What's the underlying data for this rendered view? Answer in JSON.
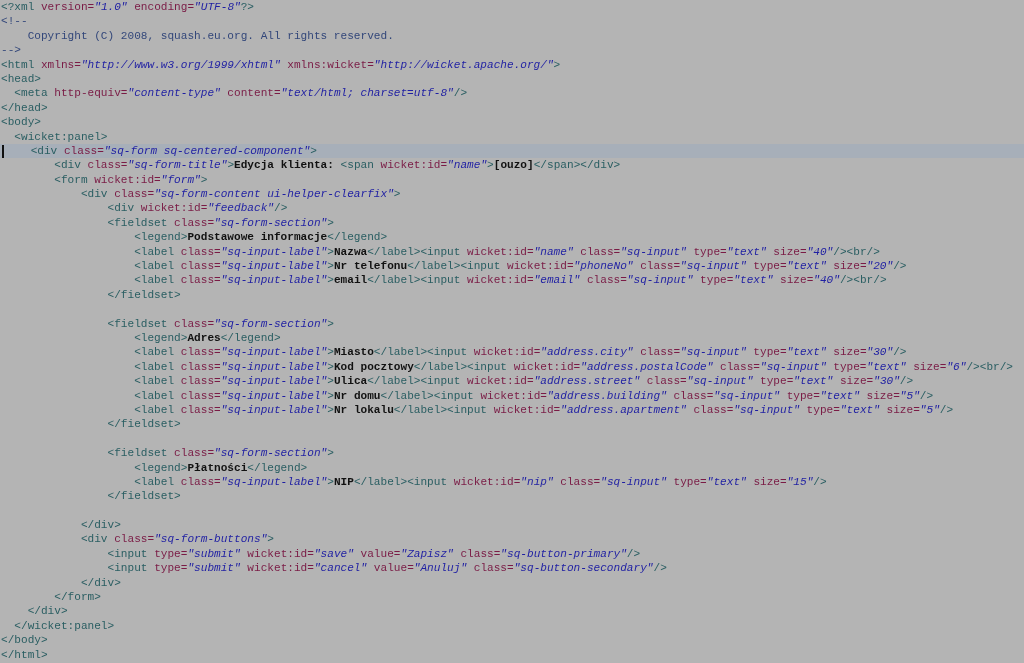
{
  "editor": {
    "lines": [
      {
        "kind": "code",
        "current": false,
        "tokens": [
          {
            "kind": "tag",
            "text": "<?xml"
          },
          {
            "kind": "attr",
            "text": " version="
          },
          {
            "kind": "value",
            "text": "\"1.0\""
          },
          {
            "kind": "attr",
            "text": " encoding="
          },
          {
            "kind": "value",
            "text": "\"UTF-8\""
          },
          {
            "kind": "tag",
            "text": "?>"
          }
        ]
      },
      {
        "kind": "code",
        "current": false,
        "tokens": [
          {
            "kind": "comment",
            "text": "<!--"
          }
        ]
      },
      {
        "kind": "code",
        "current": false,
        "tokens": [
          {
            "kind": "comment",
            "text": "    Copyright (C) 2008, squash.eu.org. All rights reserved."
          }
        ]
      },
      {
        "kind": "code",
        "current": false,
        "tokens": [
          {
            "kind": "comment",
            "text": "-->"
          }
        ]
      },
      {
        "kind": "code",
        "current": false,
        "tokens": [
          {
            "kind": "tag",
            "text": "<html"
          },
          {
            "kind": "attr",
            "text": " xmlns="
          },
          {
            "kind": "value",
            "text": "\"http://www.w3.org/1999/xhtml\""
          },
          {
            "kind": "attr",
            "text": " xmlns:wicket="
          },
          {
            "kind": "value",
            "text": "\"http://wicket.apache.org/\""
          },
          {
            "kind": "tag",
            "text": ">"
          }
        ]
      },
      {
        "kind": "code",
        "current": false,
        "tokens": [
          {
            "kind": "tag",
            "text": "<head>"
          }
        ]
      },
      {
        "kind": "code",
        "current": false,
        "tokens": [
          {
            "kind": "tag",
            "text": "  <meta"
          },
          {
            "kind": "attr",
            "text": " http-equiv="
          },
          {
            "kind": "value",
            "text": "\"content-type\""
          },
          {
            "kind": "attr",
            "text": " content="
          },
          {
            "kind": "value",
            "text": "\"text/html; charset=utf-8\""
          },
          {
            "kind": "tag",
            "text": "/>"
          }
        ]
      },
      {
        "kind": "code",
        "current": false,
        "tokens": [
          {
            "kind": "tag",
            "text": "</head>"
          }
        ]
      },
      {
        "kind": "code",
        "current": false,
        "tokens": [
          {
            "kind": "tag",
            "text": "<body>"
          }
        ]
      },
      {
        "kind": "code",
        "current": false,
        "tokens": [
          {
            "kind": "tag",
            "text": "  <wicket:panel>"
          }
        ]
      },
      {
        "kind": "code",
        "current": true,
        "tokens": [
          {
            "kind": "tag",
            "text": "    <div"
          },
          {
            "kind": "attr",
            "text": " class="
          },
          {
            "kind": "value",
            "text": "\"sq-form sq-centered-component\""
          },
          {
            "kind": "tag",
            "text": ">"
          }
        ]
      },
      {
        "kind": "code",
        "current": false,
        "tokens": [
          {
            "kind": "tag",
            "text": "        <div"
          },
          {
            "kind": "attr",
            "text": " class="
          },
          {
            "kind": "value",
            "text": "\"sq-form-title\""
          },
          {
            "kind": "tag",
            "text": ">"
          },
          {
            "kind": "text",
            "text": "Edycja klienta: "
          },
          {
            "kind": "tag",
            "text": "<span"
          },
          {
            "kind": "attr",
            "text": " wicket:id="
          },
          {
            "kind": "value",
            "text": "\"name\""
          },
          {
            "kind": "tag",
            "text": ">"
          },
          {
            "kind": "text",
            "text": "[ouzo]"
          },
          {
            "kind": "tag",
            "text": "</span></div>"
          }
        ]
      },
      {
        "kind": "code",
        "current": false,
        "tokens": [
          {
            "kind": "tag",
            "text": "        <form"
          },
          {
            "kind": "attr",
            "text": " wicket:id="
          },
          {
            "kind": "value",
            "text": "\"form\""
          },
          {
            "kind": "tag",
            "text": ">"
          }
        ]
      },
      {
        "kind": "code",
        "current": false,
        "tokens": [
          {
            "kind": "tag",
            "text": "            <div"
          },
          {
            "kind": "attr",
            "text": " class="
          },
          {
            "kind": "value",
            "text": "\"sq-form-content ui-helper-clearfix\""
          },
          {
            "kind": "tag",
            "text": ">"
          }
        ]
      },
      {
        "kind": "code",
        "current": false,
        "tokens": [
          {
            "kind": "tag",
            "text": "                <div"
          },
          {
            "kind": "attr",
            "text": " wicket:id="
          },
          {
            "kind": "value",
            "text": "\"feedback\""
          },
          {
            "kind": "tag",
            "text": "/>"
          }
        ]
      },
      {
        "kind": "code",
        "current": false,
        "tokens": [
          {
            "kind": "tag",
            "text": "                <fieldset"
          },
          {
            "kind": "attr",
            "text": " class="
          },
          {
            "kind": "value",
            "text": "\"sq-form-section\""
          },
          {
            "kind": "tag",
            "text": ">"
          }
        ]
      },
      {
        "kind": "code",
        "current": false,
        "tokens": [
          {
            "kind": "tag",
            "text": "                    <legend>"
          },
          {
            "kind": "text",
            "text": "Podstawowe informacje"
          },
          {
            "kind": "tag",
            "text": "</legend>"
          }
        ]
      },
      {
        "kind": "code",
        "current": false,
        "tokens": [
          {
            "kind": "tag",
            "text": "                    <label"
          },
          {
            "kind": "attr",
            "text": " class="
          },
          {
            "kind": "value",
            "text": "\"sq-input-label\""
          },
          {
            "kind": "tag",
            "text": ">"
          },
          {
            "kind": "text",
            "text": "Nazwa"
          },
          {
            "kind": "tag",
            "text": "</label><input"
          },
          {
            "kind": "attr",
            "text": " wicket:id="
          },
          {
            "kind": "value",
            "text": "\"name\""
          },
          {
            "kind": "attr",
            "text": " class="
          },
          {
            "kind": "value",
            "text": "\"sq-input\""
          },
          {
            "kind": "attr",
            "text": " type="
          },
          {
            "kind": "value",
            "text": "\"text\""
          },
          {
            "kind": "attr",
            "text": " size="
          },
          {
            "kind": "value",
            "text": "\"40\""
          },
          {
            "kind": "tag",
            "text": "/><br/>"
          }
        ]
      },
      {
        "kind": "code",
        "current": false,
        "tokens": [
          {
            "kind": "tag",
            "text": "                    <label"
          },
          {
            "kind": "attr",
            "text": " class="
          },
          {
            "kind": "value",
            "text": "\"sq-input-label\""
          },
          {
            "kind": "tag",
            "text": ">"
          },
          {
            "kind": "text",
            "text": "Nr telefonu"
          },
          {
            "kind": "tag",
            "text": "</label><input"
          },
          {
            "kind": "attr",
            "text": " wicket:id="
          },
          {
            "kind": "value",
            "text": "\"phoneNo\""
          },
          {
            "kind": "attr",
            "text": " class="
          },
          {
            "kind": "value",
            "text": "\"sq-input\""
          },
          {
            "kind": "attr",
            "text": " type="
          },
          {
            "kind": "value",
            "text": "\"text\""
          },
          {
            "kind": "attr",
            "text": " size="
          },
          {
            "kind": "value",
            "text": "\"20\""
          },
          {
            "kind": "tag",
            "text": "/>"
          }
        ]
      },
      {
        "kind": "code",
        "current": false,
        "tokens": [
          {
            "kind": "tag",
            "text": "                    <label"
          },
          {
            "kind": "attr",
            "text": " class="
          },
          {
            "kind": "value",
            "text": "\"sq-input-label\""
          },
          {
            "kind": "tag",
            "text": ">"
          },
          {
            "kind": "text",
            "text": "email"
          },
          {
            "kind": "tag",
            "text": "</label><input"
          },
          {
            "kind": "attr",
            "text": " wicket:id="
          },
          {
            "kind": "value",
            "text": "\"email\""
          },
          {
            "kind": "attr",
            "text": " class="
          },
          {
            "kind": "value",
            "text": "\"sq-input\""
          },
          {
            "kind": "attr",
            "text": " type="
          },
          {
            "kind": "value",
            "text": "\"text\""
          },
          {
            "kind": "attr",
            "text": " size="
          },
          {
            "kind": "value",
            "text": "\"40\""
          },
          {
            "kind": "tag",
            "text": "/><br/>"
          }
        ]
      },
      {
        "kind": "code",
        "current": false,
        "tokens": [
          {
            "kind": "tag",
            "text": "                </fieldset>"
          }
        ]
      },
      {
        "kind": "blank",
        "current": false
      },
      {
        "kind": "code",
        "current": false,
        "tokens": [
          {
            "kind": "tag",
            "text": "                <fieldset"
          },
          {
            "kind": "attr",
            "text": " class="
          },
          {
            "kind": "value",
            "text": "\"sq-form-section\""
          },
          {
            "kind": "tag",
            "text": ">"
          }
        ]
      },
      {
        "kind": "code",
        "current": false,
        "tokens": [
          {
            "kind": "tag",
            "text": "                    <legend>"
          },
          {
            "kind": "text",
            "text": "Adres"
          },
          {
            "kind": "tag",
            "text": "</legend>"
          }
        ]
      },
      {
        "kind": "code",
        "current": false,
        "tokens": [
          {
            "kind": "tag",
            "text": "                    <label"
          },
          {
            "kind": "attr",
            "text": " class="
          },
          {
            "kind": "value",
            "text": "\"sq-input-label\""
          },
          {
            "kind": "tag",
            "text": ">"
          },
          {
            "kind": "text",
            "text": "Miasto"
          },
          {
            "kind": "tag",
            "text": "</label><input"
          },
          {
            "kind": "attr",
            "text": " wicket:id="
          },
          {
            "kind": "value",
            "text": "\"address.city\""
          },
          {
            "kind": "attr",
            "text": " class="
          },
          {
            "kind": "value",
            "text": "\"sq-input\""
          },
          {
            "kind": "attr",
            "text": " type="
          },
          {
            "kind": "value",
            "text": "\"text\""
          },
          {
            "kind": "attr",
            "text": " size="
          },
          {
            "kind": "value",
            "text": "\"30\""
          },
          {
            "kind": "tag",
            "text": "/>"
          }
        ]
      },
      {
        "kind": "code",
        "current": false,
        "tokens": [
          {
            "kind": "tag",
            "text": "                    <label"
          },
          {
            "kind": "attr",
            "text": " class="
          },
          {
            "kind": "value",
            "text": "\"sq-input-label\""
          },
          {
            "kind": "tag",
            "text": ">"
          },
          {
            "kind": "text",
            "text": "Kod pocztowy"
          },
          {
            "kind": "tag",
            "text": "</label><input"
          },
          {
            "kind": "attr",
            "text": " wicket:id="
          },
          {
            "kind": "value",
            "text": "\"address.postalCode\""
          },
          {
            "kind": "attr",
            "text": " class="
          },
          {
            "kind": "value",
            "text": "\"sq-input\""
          },
          {
            "kind": "attr",
            "text": " type="
          },
          {
            "kind": "value",
            "text": "\"text\""
          },
          {
            "kind": "attr",
            "text": " size="
          },
          {
            "kind": "value",
            "text": "\"6\""
          },
          {
            "kind": "tag",
            "text": "/><br/>"
          }
        ]
      },
      {
        "kind": "code",
        "current": false,
        "tokens": [
          {
            "kind": "tag",
            "text": "                    <label"
          },
          {
            "kind": "attr",
            "text": " class="
          },
          {
            "kind": "value",
            "text": "\"sq-input-label\""
          },
          {
            "kind": "tag",
            "text": ">"
          },
          {
            "kind": "text",
            "text": "Ulica"
          },
          {
            "kind": "tag",
            "text": "</label><input"
          },
          {
            "kind": "attr",
            "text": " wicket:id="
          },
          {
            "kind": "value",
            "text": "\"address.street\""
          },
          {
            "kind": "attr",
            "text": " class="
          },
          {
            "kind": "value",
            "text": "\"sq-input\""
          },
          {
            "kind": "attr",
            "text": " type="
          },
          {
            "kind": "value",
            "text": "\"text\""
          },
          {
            "kind": "attr",
            "text": " size="
          },
          {
            "kind": "value",
            "text": "\"30\""
          },
          {
            "kind": "tag",
            "text": "/>"
          }
        ]
      },
      {
        "kind": "code",
        "current": false,
        "tokens": [
          {
            "kind": "tag",
            "text": "                    <label"
          },
          {
            "kind": "attr",
            "text": " class="
          },
          {
            "kind": "value",
            "text": "\"sq-input-label\""
          },
          {
            "kind": "tag",
            "text": ">"
          },
          {
            "kind": "text",
            "text": "Nr domu"
          },
          {
            "kind": "tag",
            "text": "</label><input"
          },
          {
            "kind": "attr",
            "text": " wicket:id="
          },
          {
            "kind": "value",
            "text": "\"address.building\""
          },
          {
            "kind": "attr",
            "text": " class="
          },
          {
            "kind": "value",
            "text": "\"sq-input\""
          },
          {
            "kind": "attr",
            "text": " type="
          },
          {
            "kind": "value",
            "text": "\"text\""
          },
          {
            "kind": "attr",
            "text": " size="
          },
          {
            "kind": "value",
            "text": "\"5\""
          },
          {
            "kind": "tag",
            "text": "/>"
          }
        ]
      },
      {
        "kind": "code",
        "current": false,
        "tokens": [
          {
            "kind": "tag",
            "text": "                    <label"
          },
          {
            "kind": "attr",
            "text": " class="
          },
          {
            "kind": "value",
            "text": "\"sq-input-label\""
          },
          {
            "kind": "tag",
            "text": ">"
          },
          {
            "kind": "text",
            "text": "Nr lokalu"
          },
          {
            "kind": "tag",
            "text": "</label><input"
          },
          {
            "kind": "attr",
            "text": " wicket:id="
          },
          {
            "kind": "value",
            "text": "\"address.apartment\""
          },
          {
            "kind": "attr",
            "text": " class="
          },
          {
            "kind": "value",
            "text": "\"sq-input\""
          },
          {
            "kind": "attr",
            "text": " type="
          },
          {
            "kind": "value",
            "text": "\"text\""
          },
          {
            "kind": "attr",
            "text": " size="
          },
          {
            "kind": "value",
            "text": "\"5\""
          },
          {
            "kind": "tag",
            "text": "/>"
          }
        ]
      },
      {
        "kind": "code",
        "current": false,
        "tokens": [
          {
            "kind": "tag",
            "text": "                </fieldset>"
          }
        ]
      },
      {
        "kind": "blank",
        "current": false
      },
      {
        "kind": "code",
        "current": false,
        "tokens": [
          {
            "kind": "tag",
            "text": "                <fieldset"
          },
          {
            "kind": "attr",
            "text": " class="
          },
          {
            "kind": "value",
            "text": "\"sq-form-section\""
          },
          {
            "kind": "tag",
            "text": ">"
          }
        ]
      },
      {
        "kind": "code",
        "current": false,
        "tokens": [
          {
            "kind": "tag",
            "text": "                    <legend>"
          },
          {
            "kind": "text",
            "text": "Płatności"
          },
          {
            "kind": "tag",
            "text": "</legend>"
          }
        ]
      },
      {
        "kind": "code",
        "current": false,
        "tokens": [
          {
            "kind": "tag",
            "text": "                    <label"
          },
          {
            "kind": "attr",
            "text": " class="
          },
          {
            "kind": "value",
            "text": "\"sq-input-label\""
          },
          {
            "kind": "tag",
            "text": ">"
          },
          {
            "kind": "text",
            "text": "NIP"
          },
          {
            "kind": "tag",
            "text": "</label><input"
          },
          {
            "kind": "attr",
            "text": " wicket:id="
          },
          {
            "kind": "value",
            "text": "\"nip\""
          },
          {
            "kind": "attr",
            "text": " class="
          },
          {
            "kind": "value",
            "text": "\"sq-input\""
          },
          {
            "kind": "attr",
            "text": " type="
          },
          {
            "kind": "value",
            "text": "\"text\""
          },
          {
            "kind": "attr",
            "text": " size="
          },
          {
            "kind": "value",
            "text": "\"15\""
          },
          {
            "kind": "tag",
            "text": "/>"
          }
        ]
      },
      {
        "kind": "code",
        "current": false,
        "tokens": [
          {
            "kind": "tag",
            "text": "                </fieldset>"
          }
        ]
      },
      {
        "kind": "blank",
        "current": false
      },
      {
        "kind": "code",
        "current": false,
        "tokens": [
          {
            "kind": "tag",
            "text": "            </div>"
          }
        ]
      },
      {
        "kind": "code",
        "current": false,
        "tokens": [
          {
            "kind": "tag",
            "text": "            <div"
          },
          {
            "kind": "attr",
            "text": " class="
          },
          {
            "kind": "value",
            "text": "\"sq-form-buttons\""
          },
          {
            "kind": "tag",
            "text": ">"
          }
        ]
      },
      {
        "kind": "code",
        "current": false,
        "tokens": [
          {
            "kind": "tag",
            "text": "                <input"
          },
          {
            "kind": "attr",
            "text": " type="
          },
          {
            "kind": "value",
            "text": "\"submit\""
          },
          {
            "kind": "attr",
            "text": " wicket:id="
          },
          {
            "kind": "value",
            "text": "\"save\""
          },
          {
            "kind": "attr",
            "text": " value="
          },
          {
            "kind": "value",
            "text": "\"Zapisz\""
          },
          {
            "kind": "attr",
            "text": " class="
          },
          {
            "kind": "value",
            "text": "\"sq-button-primary\""
          },
          {
            "kind": "tag",
            "text": "/>"
          }
        ]
      },
      {
        "kind": "code",
        "current": false,
        "tokens": [
          {
            "kind": "tag",
            "text": "                <input"
          },
          {
            "kind": "attr",
            "text": " type="
          },
          {
            "kind": "value",
            "text": "\"submit\""
          },
          {
            "kind": "attr",
            "text": " wicket:id="
          },
          {
            "kind": "value",
            "text": "\"cancel\""
          },
          {
            "kind": "attr",
            "text": " value="
          },
          {
            "kind": "value",
            "text": "\"Anuluj\""
          },
          {
            "kind": "attr",
            "text": " class="
          },
          {
            "kind": "value",
            "text": "\"sq-button-secondary\""
          },
          {
            "kind": "tag",
            "text": "/>"
          }
        ]
      },
      {
        "kind": "code",
        "current": false,
        "tokens": [
          {
            "kind": "tag",
            "text": "            </div>"
          }
        ]
      },
      {
        "kind": "code",
        "current": false,
        "tokens": [
          {
            "kind": "tag",
            "text": "        </form>"
          }
        ]
      },
      {
        "kind": "code",
        "current": false,
        "tokens": [
          {
            "kind": "tag",
            "text": "    </div>"
          }
        ]
      },
      {
        "kind": "code",
        "current": false,
        "tokens": [
          {
            "kind": "tag",
            "text": "  </wicket:panel>"
          }
        ]
      },
      {
        "kind": "code",
        "current": false,
        "tokens": [
          {
            "kind": "tag",
            "text": "</body>"
          }
        ]
      },
      {
        "kind": "code",
        "current": false,
        "tokens": [
          {
            "kind": "tag",
            "text": "</html>"
          }
        ]
      }
    ]
  }
}
